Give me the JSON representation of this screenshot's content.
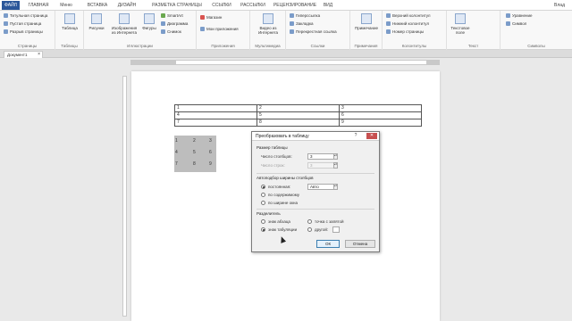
{
  "tabs": [
    "ФАЙЛ",
    "ГЛАВНАЯ",
    "Меню",
    "ВСТАВКА",
    "ДИЗАЙН",
    "РАЗМЕТКА СТРАНИЦЫ",
    "ССЫЛКИ",
    "РАССЫЛКИ",
    "РЕЦЕНЗИРОВАНИЕ",
    "ВИД"
  ],
  "user": "Влад",
  "ribbon": {
    "pages": {
      "items": [
        "Титульная страница",
        "Пустая страница",
        "Разрыв страницы"
      ],
      "label": "Страницы"
    },
    "tables": {
      "button": "Таблица",
      "label": "Таблицы"
    },
    "illustrations": {
      "pictures": "Рисунки",
      "online": "Изображения из Интернета",
      "shapes": "Фигуры",
      "smartart": "SmartArt",
      "chart": "Диаграмма",
      "screenshot": "Снимок",
      "label": "Иллюстрации"
    },
    "apps": {
      "store": "Магазин",
      "myapps": "Мои приложения",
      "label": "Приложения"
    },
    "media": {
      "video": "Видео из Интернета",
      "label": "Мультимедиа"
    },
    "links": {
      "hyperlink": "Гиперссылка",
      "bookmark": "Закладка",
      "crossref": "Перекрестная ссылка",
      "label": "Ссылки"
    },
    "comments": {
      "button": "Примечание",
      "label": "Примечания"
    },
    "headerfooter": {
      "header": "Верхний колонтитул",
      "footer": "Нижний колонтитул",
      "pagenum": "Номер страницы",
      "label": "Колонтитулы"
    },
    "text": {
      "textbox": "Текстовое поле",
      "label": "Текст"
    },
    "symbols": {
      "equation": "Уравнение",
      "symbol": "Символ",
      "label": "Символы"
    }
  },
  "document": {
    "tab": "Документ1",
    "table": [
      [
        "1",
        "2",
        "3"
      ],
      [
        "4",
        "5",
        "6"
      ],
      [
        "7",
        "8",
        "9"
      ]
    ],
    "selected_text": [
      [
        "1",
        "2",
        "3"
      ],
      [
        "4",
        "5",
        "6"
      ],
      [
        "7",
        "8",
        "9"
      ]
    ]
  },
  "dialog": {
    "title": "Преобразовать в таблицу",
    "size_section": "Размер таблицы",
    "cols_label": "Число столбцов:",
    "cols_value": "3",
    "rows_label": "Число строк:",
    "rows_value": "3",
    "autofit_section": "Автоподбор ширины столбцов",
    "fixed_label": "постоянная:",
    "fixed_value": "Авто",
    "content_label": "по содержимому",
    "window_label": "по ширине окна",
    "sep_section": "Разделитель",
    "para_label": "знак абзаца",
    "semicolon_label": "точка с запятой",
    "tab_label": "знак табуляции",
    "other_label": "другой:",
    "ok": "ОК",
    "cancel": "Отмена"
  }
}
